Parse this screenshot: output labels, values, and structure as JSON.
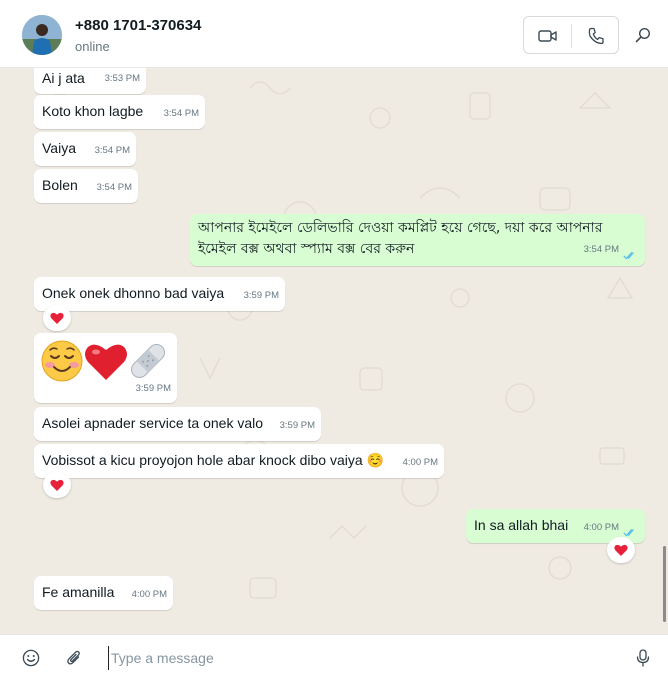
{
  "header": {
    "contact_name": "+880 1701-370634",
    "status": "online",
    "actions": [
      "video-call-icon",
      "voice-call-icon",
      "search-icon"
    ]
  },
  "messages": [
    {
      "direction": "incoming",
      "text": "Ai j ata",
      "time": "3:53 PM"
    },
    {
      "direction": "incoming",
      "text": "Koto khon lagbe",
      "time": "3:54 PM"
    },
    {
      "direction": "incoming",
      "text": "Vaiya",
      "time": "3:54 PM"
    },
    {
      "direction": "incoming",
      "text": "Bolen",
      "time": "3:54 PM"
    },
    {
      "direction": "outgoing",
      "text": "আপনার ইমেইলে ডেলিভারি দেওয়া কমপ্লিট হয়ে গেছে, দয়া করে আপনার ইমেইল বক্স অথবা স্প্যাম বক্স বের করুন",
      "time": "3:54 PM",
      "read": true
    },
    {
      "direction": "incoming",
      "text": "Onek onek dhonno bad vaiya",
      "time": "3:59 PM",
      "reaction": "❤️"
    },
    {
      "direction": "incoming",
      "text": "☺️❤️🩹",
      "time": "3:59 PM"
    },
    {
      "direction": "incoming",
      "text": "Asolei apnader service ta onek valo",
      "time": "3:59 PM"
    },
    {
      "direction": "incoming",
      "text": "Vobissot a kicu proyojon hole abar knock dibo vaiya ☺️",
      "time": "4:00 PM",
      "reaction": "❤️"
    },
    {
      "direction": "outgoing",
      "text": "In sa allah bhai",
      "time": "4:00 PM",
      "read": true,
      "reaction": "❤️"
    },
    {
      "direction": "incoming",
      "text": "Fe amanilla",
      "time": "4:00 PM"
    }
  ],
  "composer": {
    "placeholder": "Type a message",
    "value": ""
  },
  "colors": {
    "incoming_bubble": "#ffffff",
    "outgoing_bubble": "#d9fdd3",
    "chat_background": "#efeae2",
    "read_ticks": "#53bdeb",
    "reaction_heart": "#e8213a"
  }
}
